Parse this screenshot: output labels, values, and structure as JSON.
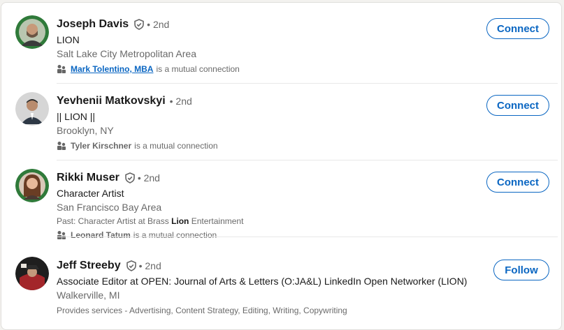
{
  "accent_color": "#0a66c2",
  "results": [
    {
      "name": "Joseph Davis",
      "verified": true,
      "degree": "• 2nd",
      "headline": "LION",
      "location": "Salt Lake City Metropolitan Area",
      "mutual_name": "Mark Tolentino, MBA",
      "mutual_suffix": "is a mutual connection",
      "action": "Connect",
      "avatar_ring": "#2f7a3a"
    },
    {
      "name": "Yevhenii Matkovskyi",
      "verified": false,
      "degree": "• 2nd",
      "headline": "|| LION ||",
      "location": "Brooklyn, NY",
      "mutual_name": "Tyler Kirschner",
      "mutual_suffix": "is a mutual connection",
      "action": "Connect"
    },
    {
      "name": "Rikki Muser",
      "verified": true,
      "degree": "• 2nd",
      "headline": "Character Artist",
      "location": "San Francisco Bay Area",
      "past_prefix": "Past: Character Artist at Brass ",
      "past_highlight": "Lion",
      "past_suffix": " Entertainment",
      "mutual_name": "Leonard Tatum",
      "mutual_suffix": "is a mutual connection",
      "action": "Connect",
      "avatar_ring": "#2f7a3a"
    },
    {
      "name": "Jeff Streeby",
      "verified": true,
      "degree": "• 2nd",
      "headline": "Associate Editor at OPEN: Journal of Arts & Letters (O:JA&L) LinkedIn Open Networker (LION)",
      "location": "Walkerville, MI",
      "services": "Provides services - Advertising, Content Strategy, Editing, Writing, Copywriting",
      "action": "Follow"
    }
  ]
}
